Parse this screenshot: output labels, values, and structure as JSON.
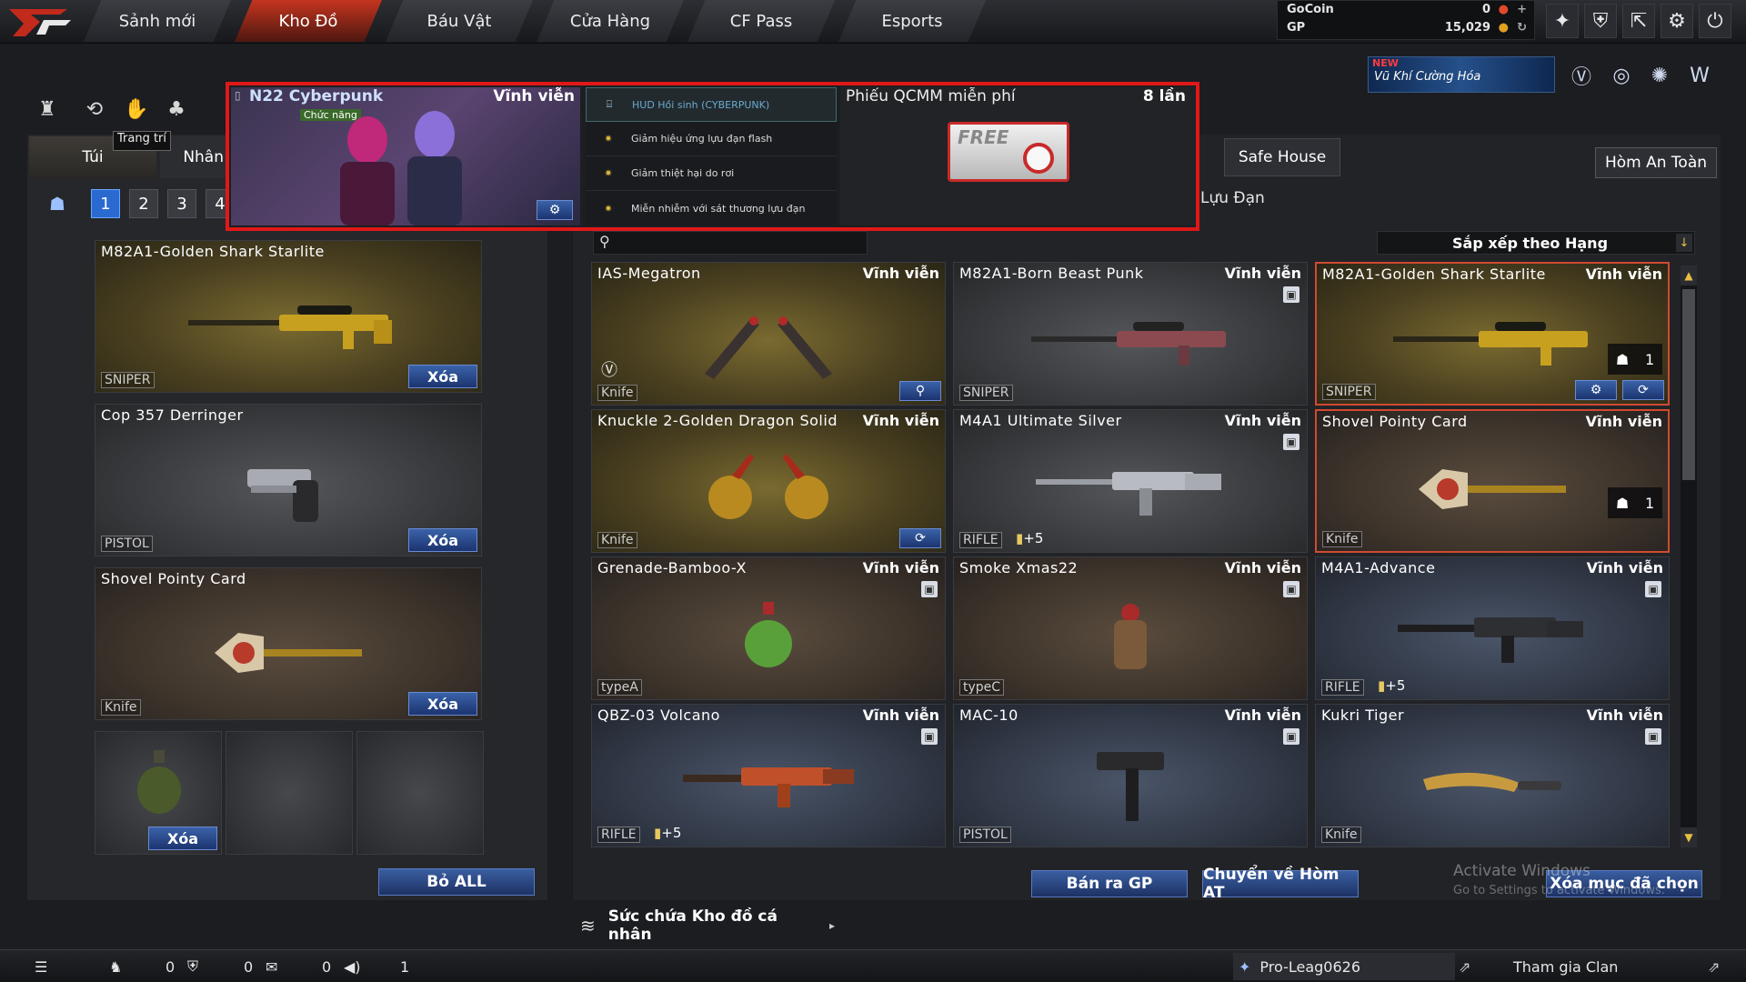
{
  "nav": {
    "logo": "CF",
    "tabs": [
      "Sảnh mới",
      "Kho Đồ",
      "Báu Vật",
      "Cửa Hàng",
      "CF Pass",
      "Esports"
    ],
    "active_tab": "Kho Đồ"
  },
  "currency": {
    "gocoin_label": "GoCoin",
    "gocoin_value": "0",
    "gp_label": "GP",
    "gp_value": "15,029"
  },
  "banner": {
    "new_label": "NEW",
    "text": "Vũ Khí Cường Hóa"
  },
  "tooltip": "Trang trí",
  "left": {
    "tabs": [
      "Túi",
      "Nhân"
    ],
    "pages": [
      "1",
      "2",
      "3",
      "4"
    ],
    "active_page": "1",
    "cards": [
      {
        "name": "M82A1-Golden Shark Starlite",
        "category": "SNIPER",
        "delete": "Xóa"
      },
      {
        "name": "Cop 357 Derringer",
        "category": "PISTOL",
        "delete": "Xóa"
      },
      {
        "name": "Shovel Pointy Card",
        "category": "Knife",
        "delete": "Xóa"
      }
    ],
    "slot_delete": "Xóa",
    "remove_all": "Bỏ ALL"
  },
  "highlight": {
    "item_name": "N22 Cyberpunk",
    "item_sub": "Chức năng",
    "item_duration": "Vĩnh viễn",
    "features": [
      "HUD Hồi sinh (CYBERPUNK)",
      "Giảm hiệu ứng lựu đạn flash",
      "Giảm thiệt hại do rơi",
      "Miễn nhiễm với sát thương lựu đạn"
    ],
    "coupon_title": "Phiếu QCMM miễn phí",
    "coupon_count": "8 lần",
    "coupon_badge": "FREE"
  },
  "right": {
    "safe_house": "Safe House",
    "safe_box": "Hòm An Toàn",
    "grenade_label": "Lựu Đạn",
    "sort_label": "Sắp xếp theo Hạng",
    "items": [
      {
        "name": "IAS-Megatron",
        "duration": "Vĩnh viễn",
        "category": "Knife"
      },
      {
        "name": "M82A1-Born Beast Punk",
        "duration": "Vĩnh viễn",
        "category": "SNIPER"
      },
      {
        "name": "M82A1-Golden Shark Starlite",
        "duration": "Vĩnh viễn",
        "category": "SNIPER",
        "qty": "1"
      },
      {
        "name": "Knuckle 2-Golden Dragon Solid",
        "duration": "Vĩnh viễn",
        "category": "Knife"
      },
      {
        "name": "M4A1 Ultimate Silver",
        "duration": "Vĩnh viễn",
        "category": "RIFLE",
        "enhance": "+5"
      },
      {
        "name": "Shovel Pointy Card",
        "duration": "Vĩnh viễn",
        "category": "Knife",
        "qty": "1"
      },
      {
        "name": "Grenade-Bamboo-X",
        "duration": "Vĩnh viễn",
        "category": "typeA"
      },
      {
        "name": "Smoke Xmas22",
        "duration": "Vĩnh viễn",
        "category": "typeC"
      },
      {
        "name": "M4A1-Advance",
        "duration": "Vĩnh viễn",
        "category": "RIFLE",
        "enhance": "+5"
      },
      {
        "name": "QBZ-03 Volcano",
        "duration": "Vĩnh viễn",
        "category": "RIFLE",
        "enhance": "+5"
      },
      {
        "name": "MAC-10",
        "duration": "Vĩnh viễn",
        "category": "PISTOL"
      },
      {
        "name": "Kukri Tiger",
        "duration": "Vĩnh viễn",
        "category": "Knife"
      }
    ],
    "sell_gp": "Bán ra GP",
    "move_safe": "Chuyển về Hòm AT",
    "delete_selected": "Xóa mục đã chọn"
  },
  "capacity": "Sức chứa Kho đồ cá nhân",
  "watermark": {
    "line1": "Activate Windows",
    "line2": "Go to Settings to activate Windows."
  },
  "footer": {
    "c1": "0",
    "c2": "0",
    "c3": "0",
    "c4": "1",
    "user": "Pro-Leag0626",
    "clan": "Tham gia Clan"
  },
  "colors": {
    "accent_red": "#e01818",
    "button_blue": "#2a4c8c",
    "gold": "#e8c860"
  }
}
